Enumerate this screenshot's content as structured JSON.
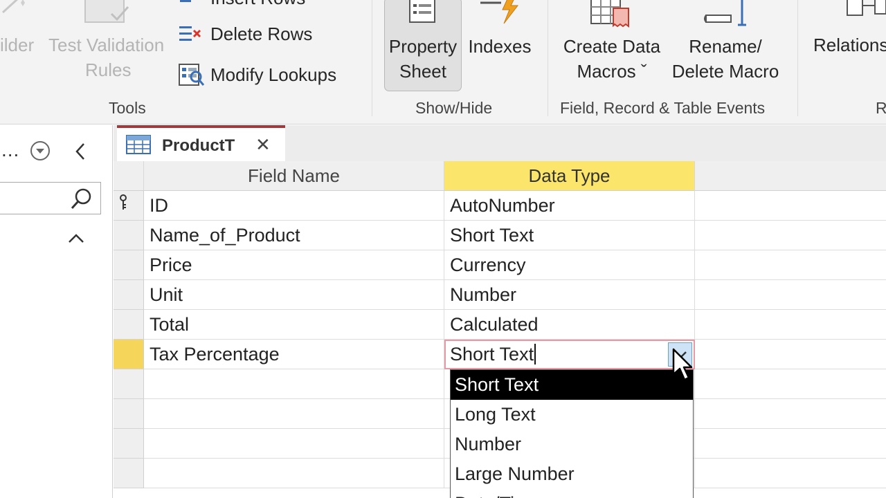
{
  "ribbon": {
    "partial_left_label": "ilder",
    "test_validation_label_line1": "Test Validation",
    "test_validation_label_line2": "Rules",
    "insert_rows_label": "Insert Rows",
    "delete_rows_label": "Delete Rows",
    "modify_lookups_label": "Modify Lookups",
    "property_sheet_line1": "Property",
    "property_sheet_line2": "Sheet",
    "indexes_label": "Indexes",
    "create_data_macros_line1": "Create Data",
    "create_data_macros_line2": "Macros ˇ",
    "rename_macro_line1": "Rename/",
    "rename_macro_line2": "Delete Macro",
    "relationships_partial": "Relations",
    "groups": {
      "tools": "Tools",
      "show_hide": "Show/Hide",
      "events": "Field, Record & Table Events",
      "relationships_partial": "R"
    }
  },
  "nav": {
    "ellipsis": "..."
  },
  "tab": {
    "title": "ProductT",
    "close_glyph": "✕"
  },
  "grid": {
    "headers": {
      "field_name": "Field Name",
      "data_type": "Data Type"
    },
    "rows": [
      {
        "field": "ID",
        "type": "AutoNumber",
        "is_key": true
      },
      {
        "field": "Name_of_Product",
        "type": "Short Text"
      },
      {
        "field": "Price",
        "type": "Currency"
      },
      {
        "field": "Unit",
        "type": "Number"
      },
      {
        "field": "Total",
        "type": "Calculated"
      },
      {
        "field": "Tax Percentage",
        "type": "Short Text",
        "current": true
      }
    ],
    "dropdown_options": [
      "Short Text",
      "Long Text",
      "Number",
      "Large Number",
      "Date/Time"
    ],
    "dropdown_selected": "Short Text"
  },
  "colors": {
    "accent_tab": "#a4373a",
    "header_highlight": "#fbe56b",
    "row_selector_current": "#f6d65a",
    "active_cell_border": "#e79aa6"
  }
}
